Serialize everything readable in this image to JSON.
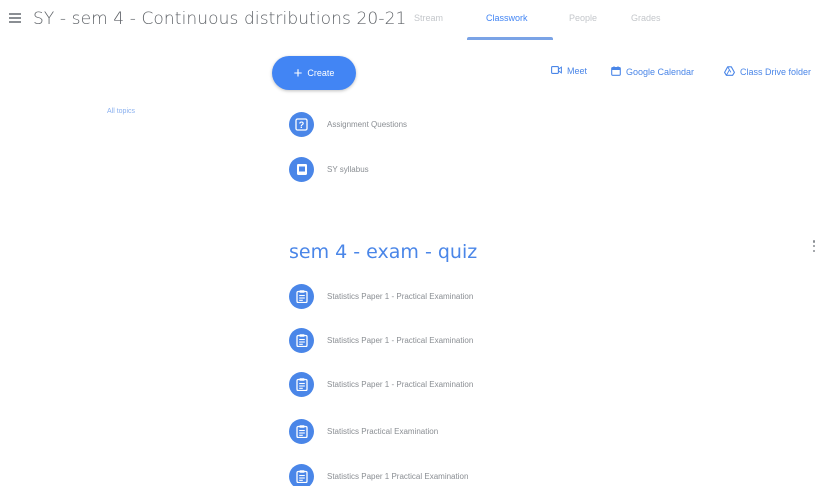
{
  "header": {
    "title": "SY - sem 4 - Continuous distributions 20-21",
    "tabs": [
      {
        "label": "Stream"
      },
      {
        "label": "Classwork"
      },
      {
        "label": "People"
      },
      {
        "label": "Grades"
      }
    ]
  },
  "toolbar": {
    "create_label": "Create",
    "create_icon": "plus-icon",
    "links": [
      {
        "label": "Meet",
        "icon": "video-icon"
      },
      {
        "label": "Google Calendar",
        "icon": "calendar-icon"
      },
      {
        "label": "Class Drive folder",
        "icon": "drive-icon"
      }
    ]
  },
  "sidebar": {
    "all_topics": "All topics"
  },
  "materials": [
    {
      "label": "Assignment Questions",
      "icon": "question-icon"
    },
    {
      "label": "SY syllabus",
      "icon": "material-icon"
    }
  ],
  "topic": {
    "title": "sem 4 - exam - quiz",
    "items": [
      {
        "label": "Statistics Paper 1 - Practical Examination",
        "icon": "quiz-assignment-icon"
      },
      {
        "label": "Statistics Paper 1 - Practical Examination",
        "icon": "quiz-assignment-icon"
      },
      {
        "label": "Statistics Paper 1 - Practical Examination",
        "icon": "quiz-assignment-icon"
      },
      {
        "label": "Statistics Practical Examination",
        "icon": "quiz-assignment-icon"
      },
      {
        "label": "Statistics Paper 1 Practical Examination",
        "icon": "quiz-assignment-icon"
      }
    ]
  },
  "colors": {
    "accent": "#4285f4",
    "icon_circle": "#4a86e8"
  }
}
